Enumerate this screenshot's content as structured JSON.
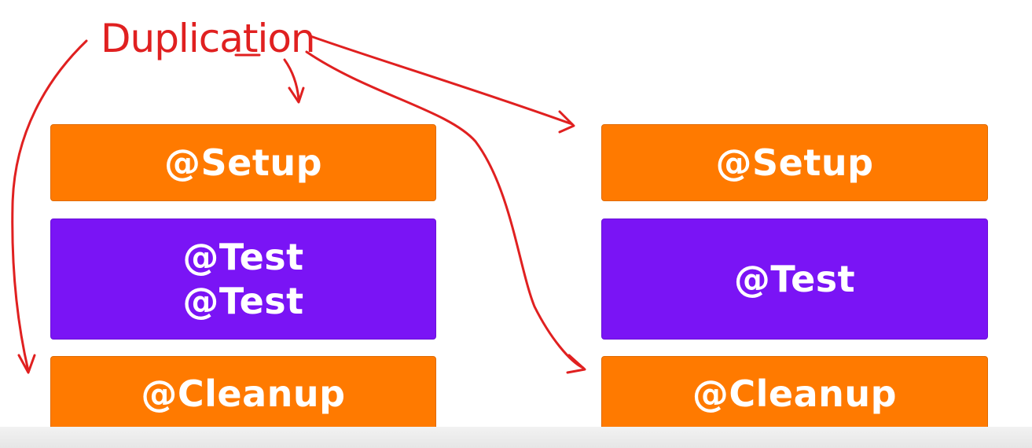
{
  "colors": {
    "setup": "#ff7a00",
    "test": "#7a14f5",
    "cleanup": "#ff7a00",
    "annotation": "#e02020"
  },
  "annotation": {
    "text": "Duplication"
  },
  "left_stack": {
    "setup": "@Setup",
    "tests": [
      "@Test",
      "@Test"
    ],
    "cleanup": "@Cleanup"
  },
  "right_stack": {
    "setup": "@Setup",
    "tests": [
      "@Test"
    ],
    "cleanup": "@Cleanup"
  }
}
